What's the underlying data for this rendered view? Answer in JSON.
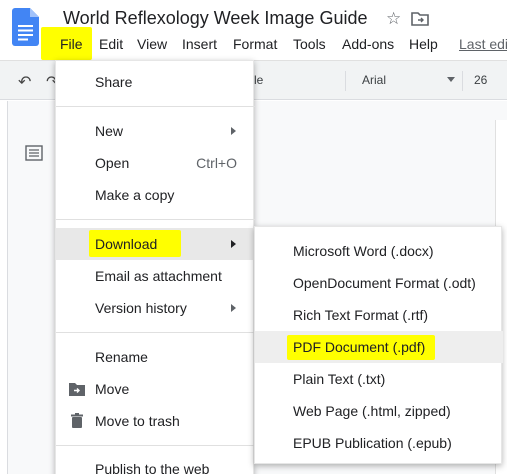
{
  "header": {
    "title": "World Reflexology Week Image Guide",
    "star_icon": "star-outline-icon",
    "folder_icon": "move-to-folder-icon",
    "last_edit": "Last edi"
  },
  "menubar": {
    "items": [
      "File",
      "Edit",
      "View",
      "Insert",
      "Format",
      "Tools",
      "Add-ons",
      "Help"
    ]
  },
  "toolbar": {
    "style_value": "itle",
    "font_value": "Arial",
    "size_value": "26"
  },
  "file_menu": {
    "share": "Share",
    "new": "New",
    "open": "Open",
    "open_shortcut": "Ctrl+O",
    "make_copy": "Make a copy",
    "download": "Download",
    "email": "Email as attachment",
    "version_history": "Version history",
    "rename": "Rename",
    "move": "Move",
    "move_to_trash": "Move to trash",
    "publish": "Publish to the web"
  },
  "download_menu": {
    "items": [
      "Microsoft Word (.docx)",
      "OpenDocument Format (.odt)",
      "Rich Text Format (.rtf)",
      "PDF Document (.pdf)",
      "Plain Text (.txt)",
      "Web Page (.html, zipped)",
      "EPUB Publication (.epub)"
    ]
  },
  "colors": {
    "highlight": "#ffff00",
    "docs_blue": "#4285f4"
  }
}
